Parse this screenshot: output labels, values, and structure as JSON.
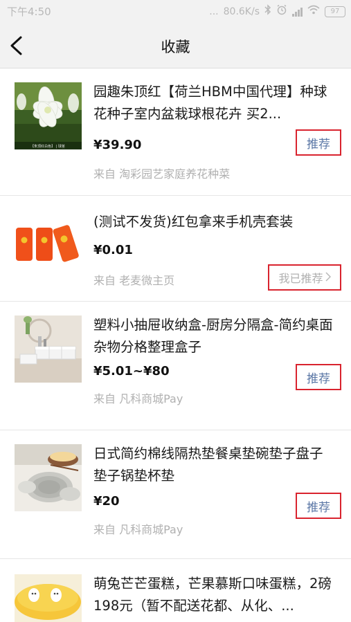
{
  "status_bar": {
    "time": "下午4:50",
    "dots": "...",
    "network_speed": "80.6K/s",
    "battery": "97"
  },
  "nav": {
    "title": "收藏"
  },
  "items": [
    {
      "title": "园趣朱顶红【荷兰HBM中国代理】种球花种子室内盆栽球根花卉 买2...",
      "price": "¥39.90",
      "source": "来自 淘彩园艺家庭养花种菜",
      "action": "推荐",
      "thumb_caption": "【朱顶红白色】 | 球茎"
    },
    {
      "title": "(测试不发货)红包拿来手机壳套装",
      "price": "¥0.01",
      "source": "来自 老麦微主页",
      "action": "我已推荐"
    },
    {
      "title": "塑料小抽屉收纳盒-厨房分隔盒-简约桌面杂物分格整理盒子",
      "price": "¥5.01~¥80",
      "source": "来自 凡科商城Pay",
      "action": "推荐"
    },
    {
      "title": "日式简约棉线隔热垫餐桌垫碗垫子盘子垫子锅垫杯垫",
      "price": "¥20",
      "source": "来自 凡科商城Pay",
      "action": "推荐"
    },
    {
      "title": "萌兔芒芒蛋糕，芒果慕斯口味蛋糕，2磅198元（暂不配送花都、从化、..."
    }
  ],
  "colors": {
    "header_bg": "#f2f2f2",
    "link_blue": "#5b77a6",
    "highlight_red": "#d9232e",
    "muted_text": "#b0b0b0"
  }
}
